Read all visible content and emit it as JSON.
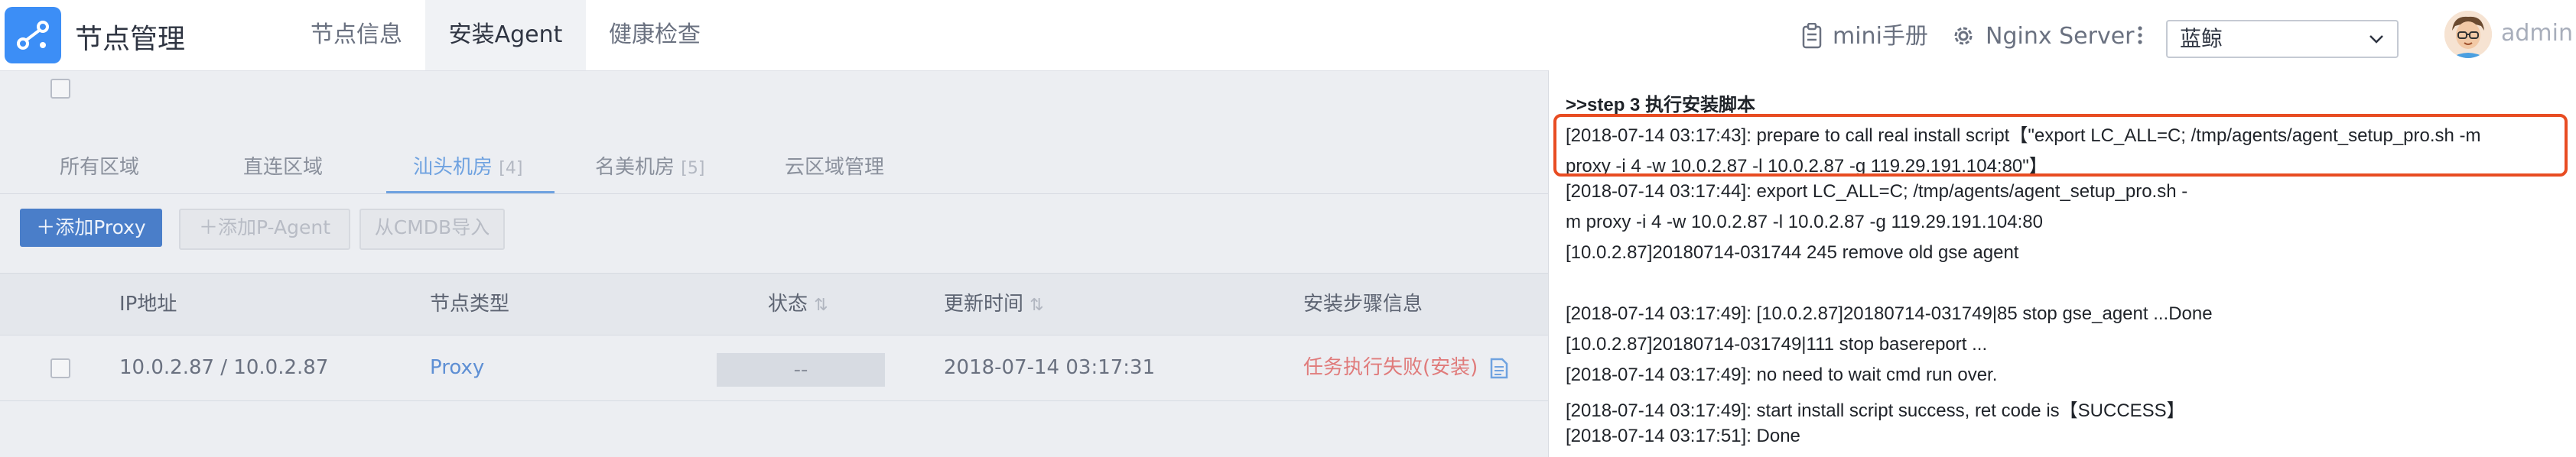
{
  "header": {
    "app_title": "节点管理",
    "nav_tabs": [
      {
        "label": "节点信息"
      },
      {
        "label": "安装Agent"
      },
      {
        "label": "健康检查"
      }
    ],
    "manual_label": "mini手册",
    "nginx_label": "Nginx Server",
    "region_select_value": "蓝鲸",
    "user_name": "admin"
  },
  "region_tabs": [
    {
      "label": "所有区域",
      "count": ""
    },
    {
      "label": "直连区域",
      "count": ""
    },
    {
      "label": "汕头机房",
      "count": "[4]"
    },
    {
      "label": "名美机房",
      "count": "[5]"
    },
    {
      "label": "云区域管理",
      "count": ""
    }
  ],
  "toolbar": {
    "add_proxy": "＋添加Proxy",
    "add_p_agent": "＋添加P-Agent",
    "import_cmdb": "从CMDB导入"
  },
  "table": {
    "headers": [
      "IP地址",
      "节点类型",
      "状态",
      "更新时间",
      "安装步骤信息"
    ],
    "sort_glyph": "⇅",
    "rows": [
      {
        "ip": "10.0.2.87 / 10.0.2.87",
        "type": "Proxy",
        "status": "--",
        "updated": "2018-07-14 03:17:31",
        "step_info": "任务执行失败(安装)"
      }
    ]
  },
  "log": {
    "lines": [
      ">>step 3 执行安装脚本",
      "[2018-07-14 03:17:43]: prepare to call real install script【\"export LC_ALL=C; /tmp/agents/agent_setup_pro.sh  -m",
      "proxy -i 4 -w 10.0.2.87 -l 10.0.2.87 -g 119.29.191.104:80\"】",
      "[2018-07-14 03:17:44]: export LC_ALL=C; /tmp/agents/agent_setup_pro.sh  -",
      "m proxy -i 4 -w 10.0.2.87 -l 10.0.2.87 -g 119.29.191.104:80",
      "[10.0.2.87]20180714-031744 245    remove old gse agent",
      "",
      "[2018-07-14 03:17:49]: [10.0.2.87]20180714-031749|85         stop gse_agent ...Done",
      "[10.0.2.87]20180714-031749|111    stop basereport ...",
      "[2018-07-14 03:17:49]: no need to wait cmd run over.",
      "[2018-07-14 03:17:49]: start install script success, ret code is【SUCCESS】",
      "[2018-07-14 03:17:51]: Done"
    ]
  },
  "colors": {
    "accent": "#3c8ef6",
    "highlight_border": "#e84c22",
    "error_text": "#e07b7b"
  }
}
